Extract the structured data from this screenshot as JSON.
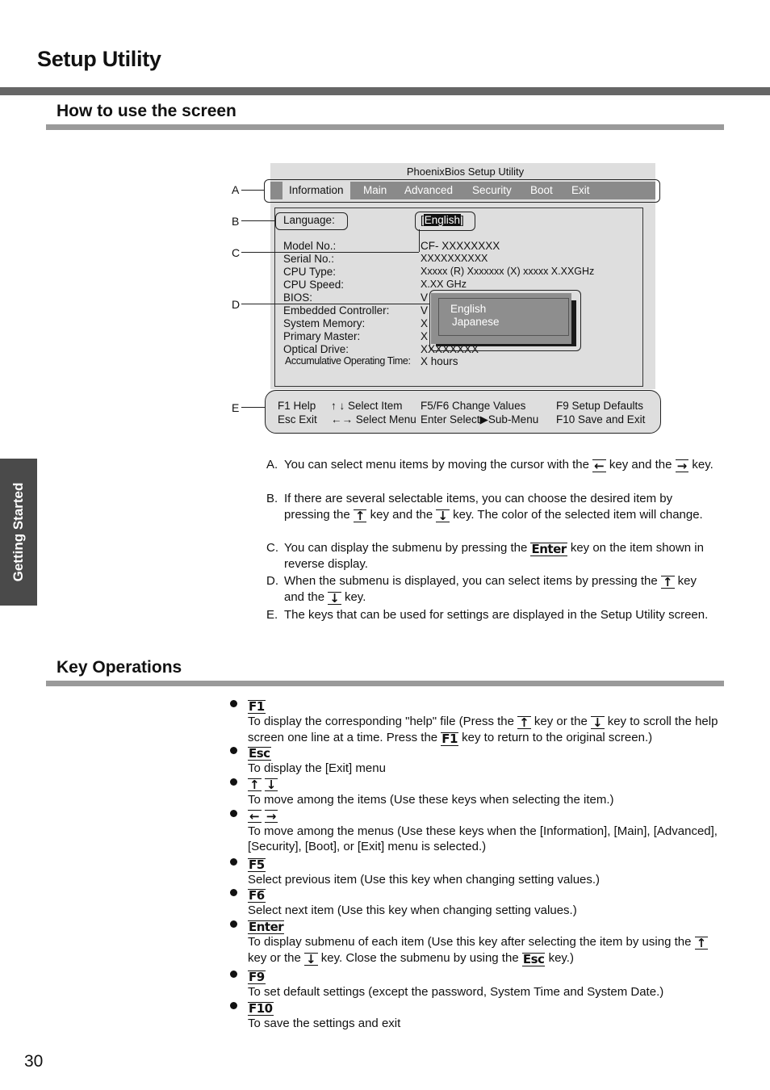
{
  "page": {
    "title": "Setup Utility",
    "side_tab": "Getting Started",
    "page_number": "30"
  },
  "section1": {
    "title": "How to use the screen"
  },
  "section2": {
    "title": "Key Operations"
  },
  "bios": {
    "title": "PhoenixBios Setup Utility",
    "menu": [
      "Information",
      "Main",
      "Advanced",
      "Security",
      "Boot",
      "Exit"
    ],
    "active_menu": "Information",
    "language_label": "Language:",
    "language_value": "English",
    "rows": [
      {
        "label": "Model No.:",
        "value": "CF- XXXXXXXX"
      },
      {
        "label": "Serial No.:",
        "value": "XXXXXXXXXX"
      },
      {
        "label": "CPU Type:",
        "value": "Xxxxx (R) Xxxxxxx (X) xxxxx X.XXGHz"
      },
      {
        "label": "CPU Speed:",
        "value": "X.XX GHz"
      },
      {
        "label": "BIOS:",
        "value": "V"
      },
      {
        "label": "Embedded Controller:",
        "value": "V"
      },
      {
        "label": "System Memory:",
        "value": "X"
      },
      {
        "label": "Primary Master:",
        "value": "X"
      },
      {
        "label": "Optical Drive:",
        "value": "XXXXXXXX"
      },
      {
        "label": "Accumulative Operating Time:",
        "value": "X hours"
      }
    ],
    "popup_options": [
      "English",
      "Japanese"
    ],
    "callouts": [
      "A",
      "B",
      "C",
      "D",
      "E"
    ],
    "keybar": {
      "row1": [
        "F1  Help",
        "↑ ↓ Select Item",
        "F5/F6 Change Values",
        "F9  Setup Defaults"
      ],
      "row2": [
        "Esc Exit",
        "←→ Select Menu",
        "Enter  Select▶Sub-Menu",
        "F10 Save and Exit"
      ]
    }
  },
  "explanations": [
    {
      "letter": "A.",
      "parts": [
        "You can select menu items by moving the cursor with the ",
        "key and the ",
        "key."
      ],
      "keys": [
        "left-arrow",
        "right-arrow"
      ]
    },
    {
      "letter": "B.",
      "parts": [
        "If there are several selectable items, you can choose the desired item by pressing the ",
        "key and the ",
        "key.  The color of the selected item will change."
      ],
      "keys": [
        "up-arrow",
        "down-arrow"
      ]
    },
    {
      "letter": "C.",
      "parts": [
        "You can display the submenu by pressing the ",
        "key on the item shown in reverse display."
      ],
      "keys": [
        "Enter"
      ]
    },
    {
      "letter": "D.",
      "parts": [
        "When the submenu is displayed, you can select items by pressing the ",
        "key and the ",
        "key."
      ],
      "keys": [
        "up-arrow",
        "down-arrow"
      ]
    },
    {
      "letter": "E.",
      "parts": [
        "The keys that can be used for settings are displayed in the Setup Utility screen."
      ],
      "keys": []
    }
  ],
  "key_operations": [
    {
      "key": "F1",
      "desc_parts": [
        "To display the corresponding \"help\" file (Press the ",
        " key or the ",
        " key to scroll the help screen one line at a time. Press the ",
        " key to return to the original screen.)"
      ],
      "inline_keys": [
        "↑",
        "↓",
        "F1"
      ]
    },
    {
      "key": "Esc",
      "desc_parts": [
        "To display the [Exit] menu"
      ],
      "inline_keys": []
    },
    {
      "key": "↑ ↓",
      "desc_parts": [
        "To move among the items (Use these keys when selecting the item.)"
      ],
      "inline_keys": []
    },
    {
      "key": "← →",
      "desc_parts": [
        "To move among the menus (Use these keys when the [Information], [Main], [Advanced], [Security], [Boot], or [Exit] menu is selected.)"
      ],
      "inline_keys": []
    },
    {
      "key": "F5",
      "desc_parts": [
        "Select previous item (Use this key when changing setting values.)"
      ],
      "inline_keys": []
    },
    {
      "key": "F6",
      "desc_parts": [
        "Select next item (Use this key when changing setting values.)"
      ],
      "inline_keys": []
    },
    {
      "key": "Enter",
      "desc_parts": [
        "To display submenu of each item (Use this key after selecting the item by using the ",
        " key or the ",
        " key. Close the submenu by using the ",
        " key.)"
      ],
      "inline_keys": [
        "↑",
        "↓",
        "Esc"
      ]
    },
    {
      "key": "F9",
      "desc_parts": [
        "To set default settings (except the password, System Time and System Date.)"
      ],
      "inline_keys": []
    },
    {
      "key": "F10",
      "desc_parts": [
        "To save the settings and exit"
      ],
      "inline_keys": []
    }
  ]
}
